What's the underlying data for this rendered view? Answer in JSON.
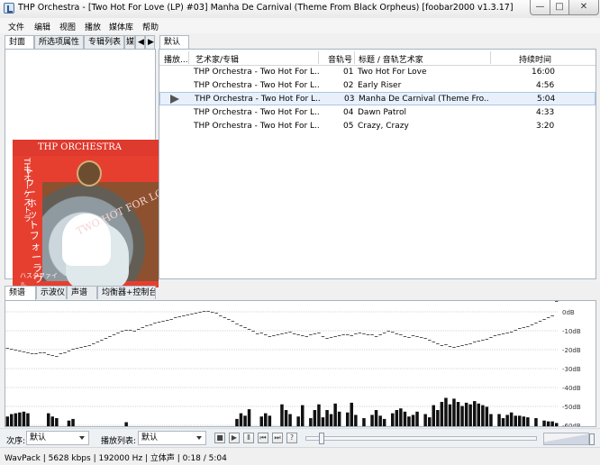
{
  "window": {
    "title": "THP Orchestra - [Two Hot For Love (LP) #03] Manha De Carnival (Theme From Black Orpheus)  [foobar2000 v1.3.17]",
    "minimize": "—",
    "maximize": "□",
    "close": "✕"
  },
  "menus": [
    "文件",
    "编辑",
    "视图",
    "播放",
    "媒体库",
    "帮助"
  ],
  "left_tabs": [
    "封面",
    "所选项属性",
    "专辑列表",
    "媒"
  ],
  "left_tab_arrows": [
    "◀",
    "▶"
  ],
  "playlist_tab": "默认",
  "album_art": {
    "header": "THP ORCHESTRA",
    "vertical_text": "トゥーホットフォーラヴ",
    "katakana": "THPオーケストラ",
    "cover_title": "TWO HOT FOR LOVE",
    "signature": "ハスタファイル"
  },
  "playlist": {
    "columns": [
      "播放...",
      "艺术家/专辑",
      "音轨号",
      "标题 / 音轨艺术家",
      "持续时间"
    ],
    "rows": [
      {
        "artist_album": "THP Orchestra - Two Hot For L...",
        "track": "01",
        "title": "Two Hot For Love",
        "duration": "16:00"
      },
      {
        "artist_album": "THP Orchestra - Two Hot For L...",
        "track": "02",
        "title": "Early Riser",
        "duration": "4:56"
      },
      {
        "artist_album": "THP Orchestra - Two Hot For L...",
        "track": "03",
        "title": "Manha De Carnival (Theme Fro...",
        "duration": "5:04",
        "selected": true
      },
      {
        "artist_album": "THP Orchestra - Two Hot For L...",
        "track": "04",
        "title": "Dawn Patrol",
        "duration": "4:33"
      },
      {
        "artist_album": "THP Orchestra - Two Hot For L...",
        "track": "05",
        "title": "Crazy, Crazy",
        "duration": "3:20"
      }
    ]
  },
  "visual_tabs": [
    "频谱",
    "示波仪",
    "声谱",
    "均衡器+控制台"
  ],
  "spectrum": {
    "db_labels": [
      "0dB",
      "-10dB",
      "-20dB",
      "-30dB",
      "-40dB",
      "-50dB",
      "-60dB"
    ],
    "bars": [
      12,
      15,
      16,
      17,
      18,
      16,
      0,
      0,
      0,
      0,
      16,
      12,
      10,
      0,
      0,
      7,
      9,
      0,
      0,
      0,
      0,
      0,
      0,
      0,
      0,
      0,
      0,
      0,
      0,
      5,
      0,
      0,
      0,
      0,
      0,
      0,
      0,
      0,
      0,
      0,
      0,
      0,
      0,
      0,
      0,
      0,
      0,
      0,
      0,
      0,
      0,
      0,
      0,
      0,
      0,
      0,
      9,
      16,
      13,
      21,
      0,
      0,
      12,
      16,
      13,
      0,
      0,
      27,
      20,
      15,
      0,
      12,
      26,
      0,
      10,
      20,
      27,
      11,
      20,
      15,
      28,
      18,
      0,
      17,
      29,
      14,
      0,
      10,
      0,
      14,
      20,
      13,
      9,
      0,
      16,
      20,
      22,
      18,
      12,
      14,
      18,
      0,
      15,
      11,
      26,
      20,
      30,
      35,
      27,
      34,
      30,
      25,
      29,
      27,
      31,
      28,
      26,
      24,
      15,
      0,
      15,
      10,
      14,
      17,
      13,
      13,
      12,
      11,
      0,
      10,
      0,
      7,
      6,
      6,
      4
    ],
    "peaks": [
      44,
      45,
      46,
      47,
      48,
      49,
      50,
      50,
      49,
      49,
      51,
      52,
      53,
      50,
      49,
      47,
      45,
      44,
      43,
      42,
      41,
      39,
      37,
      35,
      33,
      31,
      29,
      27,
      25,
      24,
      24,
      25,
      23,
      21,
      19,
      18,
      16,
      15,
      14,
      13,
      12,
      10,
      9,
      8,
      7,
      6,
      5,
      4,
      3,
      3,
      4,
      5,
      8,
      10,
      12,
      14,
      17,
      19,
      21,
      23,
      25,
      28,
      27,
      29,
      31,
      30,
      29,
      28,
      27,
      26,
      28,
      29,
      30,
      31,
      29,
      28,
      27,
      31,
      33,
      32,
      31,
      30,
      29,
      29,
      30,
      28,
      27,
      28,
      29,
      29,
      31,
      29,
      27,
      25,
      26,
      28,
      29,
      31,
      32,
      30,
      31,
      32,
      33,
      35,
      37,
      39,
      41,
      40,
      42,
      43,
      42,
      41,
      40,
      39,
      37,
      36,
      35,
      34,
      32,
      30,
      29,
      28,
      27,
      26,
      24,
      22,
      21,
      20,
      18,
      16,
      14,
      12,
      10,
      8
    ]
  },
  "toolbar": {
    "order_label": "次序:",
    "order_value": "默认",
    "playlist_label": "播放列表:",
    "playlist_value": "默认"
  },
  "controls": [
    "stop",
    "play",
    "pause",
    "previous",
    "next",
    "random"
  ],
  "playback": {
    "position": 0.04,
    "volume": 1.0
  },
  "status": "WavPack | 5628 kbps | 192000 Hz | 立体声 | 0:18 / 5:04"
}
